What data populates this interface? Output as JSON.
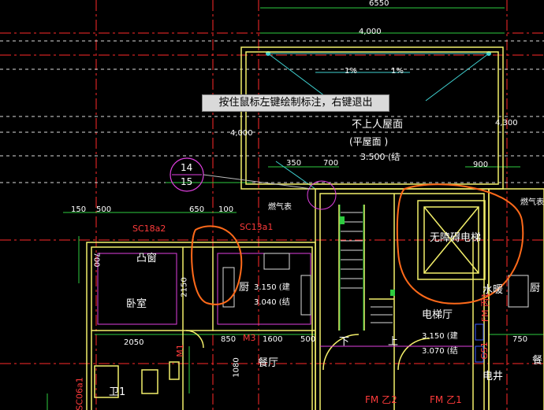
{
  "tooltip": "按住鼠标左键绘制标注，右键退出",
  "dimensions": {
    "top_total": "6550",
    "top_inner": "4,000",
    "slope_left": "1%",
    "slope_right": "1%",
    "left_4000": "4,000",
    "right_4000": "4,300",
    "d350": "350",
    "d700": "700",
    "d900": "900",
    "d150": "150",
    "d500": "500",
    "d650": "650",
    "d100": "100",
    "d2050": "2050",
    "d850": "850",
    "d1600": "1600",
    "d500b": "500",
    "d750": "750",
    "d700v": "700",
    "d2150": "2150",
    "d1080": "1080"
  },
  "roof": {
    "line1": "不上人屋面",
    "line2": "(平屋面   )",
    "line3": "3.500  (结"
  },
  "circle_tag": {
    "top": "14",
    "bottom": "15"
  },
  "labels": {
    "gas_left": "燃气表",
    "gas_right": "燃气表",
    "window_left": "SC18a2",
    "window_mid": "SC13a1",
    "occupancy_window": "凸窗",
    "bedroom": "卧室",
    "kitchen": "厨",
    "kitchen_elev1": "3.150 (建",
    "kitchen_elev2": "3.040 (结",
    "dining": "餐厅",
    "dining_right": "餐",
    "m1": "M1",
    "m3": "M3",
    "elevator": "无障碍电梯",
    "elevator_hall": "电梯厅",
    "hall_elev1": "3.150 (建",
    "hall_elev2": "3.070 (结",
    "water_well": "水暖",
    "fm_right_vertical": "FM 丙1",
    "gs1": "GS1",
    "electric_well": "电井",
    "stair_down": "下",
    "stair_up": "上",
    "fm_z2": "FM 乙2",
    "fm_z1": "FM 乙1",
    "bath": "卫1",
    "sc_bottom": "SC06a1",
    "kitchen_right": "厨"
  },
  "colors": {
    "bg": "#000000",
    "red_axis": "#ff2a2a",
    "yellow_wall": "#f3ef6a",
    "green_dim": "#2ecc40",
    "cyan": "#3fd0d0",
    "magenta": "#e040e0",
    "orange_markup": "#ff6a1a",
    "blue": "#3a5cff"
  }
}
